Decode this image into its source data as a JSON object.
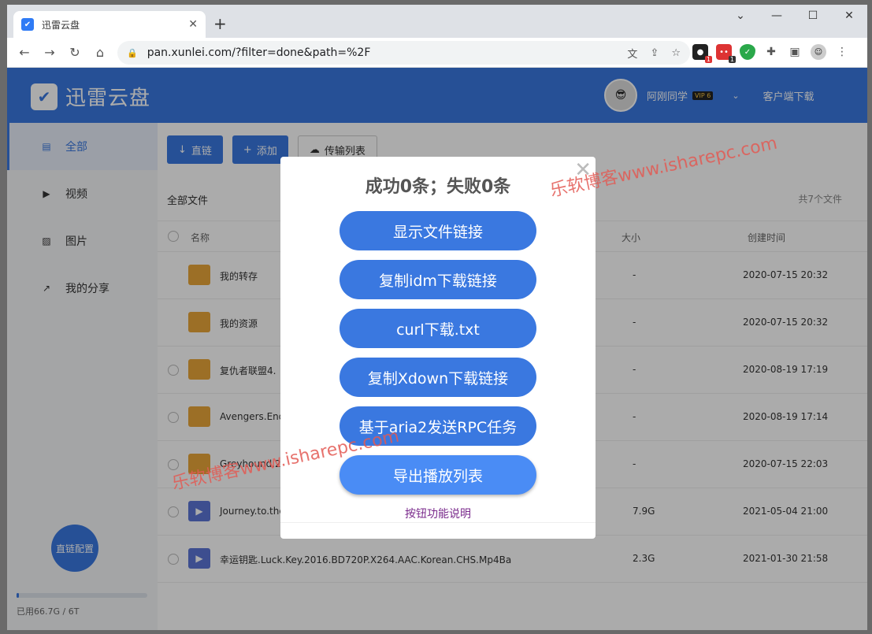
{
  "browser": {
    "tab_title": "迅雷云盘",
    "url": "pan.xunlei.com/?filter=done&path=%2F",
    "ext_badge_1": "1",
    "ext_badge_2": "1"
  },
  "app": {
    "logo_text": "迅雷云盘",
    "username": "阿刚同学",
    "vip_label": "VIP 6",
    "client_download": "客户端下载"
  },
  "sidebar": {
    "items": [
      {
        "label": "全部"
      },
      {
        "label": "视频"
      },
      {
        "label": "图片"
      },
      {
        "label": "我的分享"
      }
    ],
    "config_button": "直链配置",
    "quota_text": "已用66.7G / 6T",
    "quota_fraction": 0.011
  },
  "toolbar": {
    "direct_link": "直链",
    "add": "添加",
    "transfer_list": "传输列表"
  },
  "files": {
    "breadcrumb": "全部文件",
    "count": "共7个文件",
    "col_name": "名称",
    "col_size": "大小",
    "col_created": "创建时间",
    "rows": [
      {
        "name": "我的转存",
        "size": "-",
        "date": "2020-07-15 20:32",
        "type": "folder"
      },
      {
        "name": "我的资源",
        "size": "-",
        "date": "2020-07-15 20:32",
        "type": "folder"
      },
      {
        "name": "复仇者联盟4.",
        "size": "-",
        "date": "2020-08-19 17:19",
        "type": "folder"
      },
      {
        "name": "Avengers.End",
        "size": "-",
        "date": "2020-08-19 17:14",
        "type": "folder"
      },
      {
        "name": "Greyhound.20",
        "size": "-",
        "date": "2020-07-15 22:03",
        "type": "folder"
      },
      {
        "name": "Journey.to.the",
        "size": "7.9G",
        "date": "2021-05-04 21:00",
        "type": "video"
      },
      {
        "name": "幸运钥匙.Luck.Key.2016.BD720P.X264.AAC.Korean.CHS.Mp4Ba",
        "size": "2.3G",
        "date": "2021-01-30 21:58",
        "type": "video"
      }
    ]
  },
  "dialog": {
    "title": "成功0条；失败0条",
    "buttons": [
      "显示文件链接",
      "复制idm下载链接",
      "curl下载.txt",
      "复制Xdown下载链接",
      "基于aria2发送RPC任务",
      "导出播放列表"
    ],
    "help_link": "按钮功能说明"
  },
  "watermark": {
    "text_1": "乐软博客www.isharepc.com",
    "text_2": "乐软博客www.isharepc.com"
  }
}
